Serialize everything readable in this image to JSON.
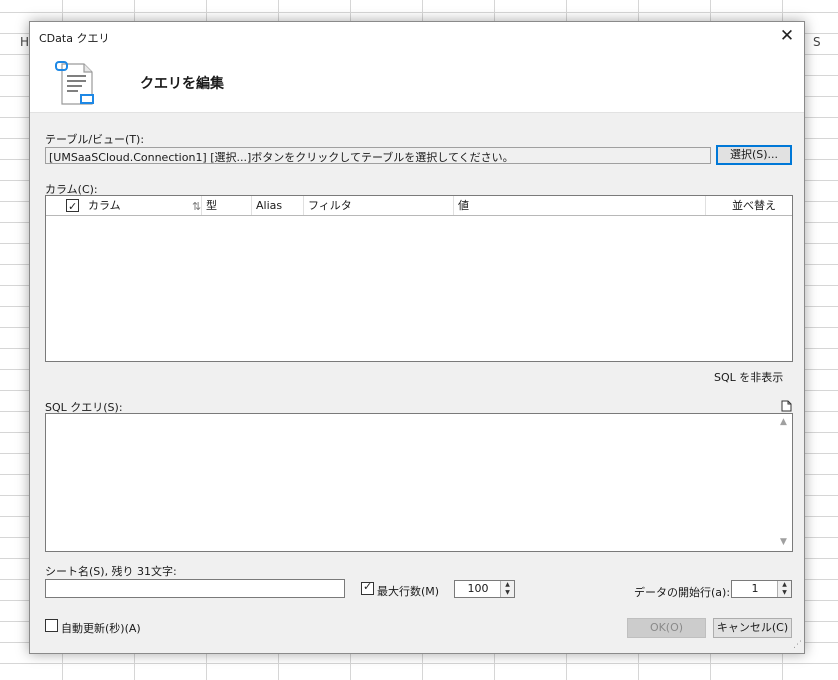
{
  "background": {
    "col_h": "H",
    "col_s": "S"
  },
  "dialog": {
    "title": "CData クエリ",
    "close_glyph": "✕",
    "header_title": "クエリを編集"
  },
  "table": {
    "label": "テーブル/ビュー(T):",
    "value": "[UMSaaSCloud.Connection1] [選択...]ボタンをクリックしてテーブルを選択してください。",
    "select_button": "選択(S)..."
  },
  "columns": {
    "label": "カラム(C):",
    "headers": [
      "カラム",
      "型",
      "Alias",
      "フィルタ",
      "値",
      "並べ替え"
    ],
    "select_all_checked": true,
    "sort_glyph": "⇅"
  },
  "sql": {
    "toggle_link": "SQL を非表示",
    "label": "SQL クエリ(S):",
    "value": ""
  },
  "sheet": {
    "label": "シート名(S), 残り 31文字:",
    "value": ""
  },
  "max_rows": {
    "checked": true,
    "label": "最大行数(M)",
    "value": "100"
  },
  "start_row": {
    "label": "データの開始行(a):",
    "value": "1"
  },
  "auto_refresh": {
    "checked": false,
    "label": "自動更新(秒)(A)"
  },
  "buttons": {
    "ok": "OK(O)",
    "cancel": "キャンセル(C)"
  },
  "colors": {
    "accent": "#0078d7",
    "dialog_bg": "#f0f0f0",
    "icon_blue": "#1e88e5"
  }
}
